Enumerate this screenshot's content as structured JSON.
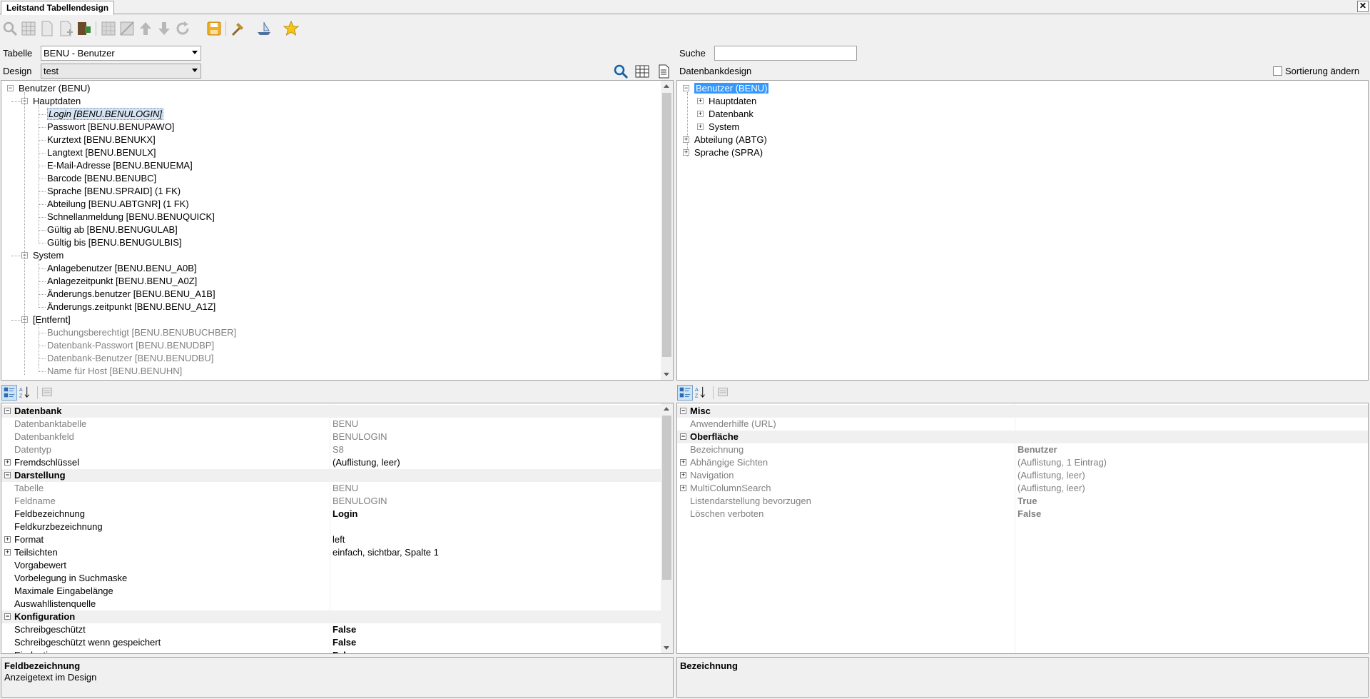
{
  "window": {
    "tab_title": "Leitstand Tabellendesign",
    "close": "✕"
  },
  "toolbar": {
    "icons": [
      "search-icon",
      "grid-icon",
      "page-icon",
      "page-add-icon",
      "export-icon",
      "table-icon",
      "table-diagonal-icon",
      "arrow-up-icon",
      "arrow-down-icon",
      "refresh-icon",
      "save-icon",
      "hammer-icon",
      "ship-icon",
      "star-icon"
    ]
  },
  "controls": {
    "tabelle_label": "Tabelle",
    "tabelle_value": "BENU - Benutzer",
    "design_label": "Design",
    "design_value": "test",
    "suche_label": "Suche",
    "suche_value": "",
    "datenbankdesign_label": "Datenbankdesign",
    "sortierung_label": "Sortierung ändern"
  },
  "left_tree": {
    "root": "Benutzer (BENU)",
    "groups": [
      {
        "label": "Hauptdaten",
        "items": [
          "Login [BENU.BENULOGIN]",
          "Passwort [BENU.BENUPAWO]",
          "Kurztext [BENU.BENUKX]",
          "Langtext [BENU.BENULX]",
          "E-Mail-Adresse [BENU.BENUEMA]",
          "Barcode [BENU.BENUBC]",
          "Sprache [BENU.SPRAID] (1 FK)",
          "Abteilung [BENU.ABTGNR] (1 FK)",
          "Schnellanmeldung [BENU.BENUQUICK]",
          "Gültig ab [BENU.BENUGULAB]",
          "Gültig bis [BENU.BENUGULBIS]"
        ]
      },
      {
        "label": "System",
        "items": [
          "Anlagebenutzer [BENU.BENU_A0B]",
          "Anlagezeitpunkt [BENU.BENU_A0Z]",
          "Änderungs.benutzer [BENU.BENU_A1B]",
          "Änderungs.zeitpunkt [BENU.BENU_A1Z]"
        ]
      },
      {
        "label": "[Entfernt]",
        "items": [
          "Buchungsberechtigt [BENU.BENUBUCHBER]",
          "Datenbank-Passwort [BENU.BENUDBP]",
          "Datenbank-Benutzer [BENU.BENUDBU]",
          "Name für Host [BENU.BENUHN]"
        ]
      }
    ]
  },
  "right_tree": {
    "root": "Benutzer (BENU)",
    "children": [
      "Hauptdaten",
      "Datenbank",
      "System"
    ],
    "siblings": [
      "Abteilung (ABTG)",
      "Sprache (SPRA)"
    ]
  },
  "left_props": {
    "rows": [
      {
        "type": "cat",
        "name": "Datenbank"
      },
      {
        "name": "Datenbanktabelle",
        "value": "BENU",
        "gray": true
      },
      {
        "name": "Datenbankfeld",
        "value": "BENULOGIN",
        "gray": true
      },
      {
        "name": "Datentyp",
        "value": "S8",
        "gray": true
      },
      {
        "name": "Fremdschlüssel",
        "value": "(Auflistung, leer)",
        "expand": true
      },
      {
        "type": "cat",
        "name": "Darstellung"
      },
      {
        "name": "Tabelle",
        "value": "BENU",
        "gray": true
      },
      {
        "name": "Feldname",
        "value": "BENULOGIN",
        "gray": true
      },
      {
        "name": "Feldbezeichnung",
        "value": "Login",
        "bold": true
      },
      {
        "name": "Feldkurzbezeichnung",
        "value": ""
      },
      {
        "name": "Format",
        "value": "left",
        "expand": true
      },
      {
        "name": "Teilsichten",
        "value": "einfach, sichtbar, Spalte 1",
        "expand": true
      },
      {
        "name": "Vorgabewert",
        "value": ""
      },
      {
        "name": "Vorbelegung in Suchmaske",
        "value": ""
      },
      {
        "name": "Maximale Eingabelänge",
        "value": ""
      },
      {
        "name": "Auswahllistenquelle",
        "value": ""
      },
      {
        "type": "cat",
        "name": "Konfiguration"
      },
      {
        "name": "Schreibgeschützt",
        "value": "False",
        "bold": true
      },
      {
        "name": "Schreibgeschützt wenn gespeichert",
        "value": "False",
        "bold": true
      },
      {
        "name": "Eindeutig",
        "value": "False",
        "bold": true
      }
    ]
  },
  "right_props": {
    "rows": [
      {
        "type": "cat",
        "name": "Misc"
      },
      {
        "name": "Anwenderhilfe (URL)",
        "value": "",
        "gray": true
      },
      {
        "type": "cat",
        "name": "Oberfläche"
      },
      {
        "name": "Bezeichnung",
        "value": "Benutzer",
        "gray": true,
        "boldval": true
      },
      {
        "name": "Abhängige Sichten",
        "value": "(Auflistung, 1 Eintrag)",
        "gray": true,
        "expand": true
      },
      {
        "name": "Navigation",
        "value": "(Auflistung, leer)",
        "gray": true,
        "expand": true
      },
      {
        "name": "MultiColumnSearch",
        "value": "(Auflistung, leer)",
        "gray": true,
        "expand": true
      },
      {
        "name": "Listendarstellung bevorzugen",
        "value": "True",
        "gray": true,
        "boldval": true
      },
      {
        "name": "Löschen verboten",
        "value": "False",
        "gray": true,
        "boldval": true
      }
    ]
  },
  "left_desc": {
    "title": "Feldbezeichnung",
    "text": "Anzeigetext im Design"
  },
  "right_desc": {
    "title": "Bezeichnung",
    "text": ""
  }
}
